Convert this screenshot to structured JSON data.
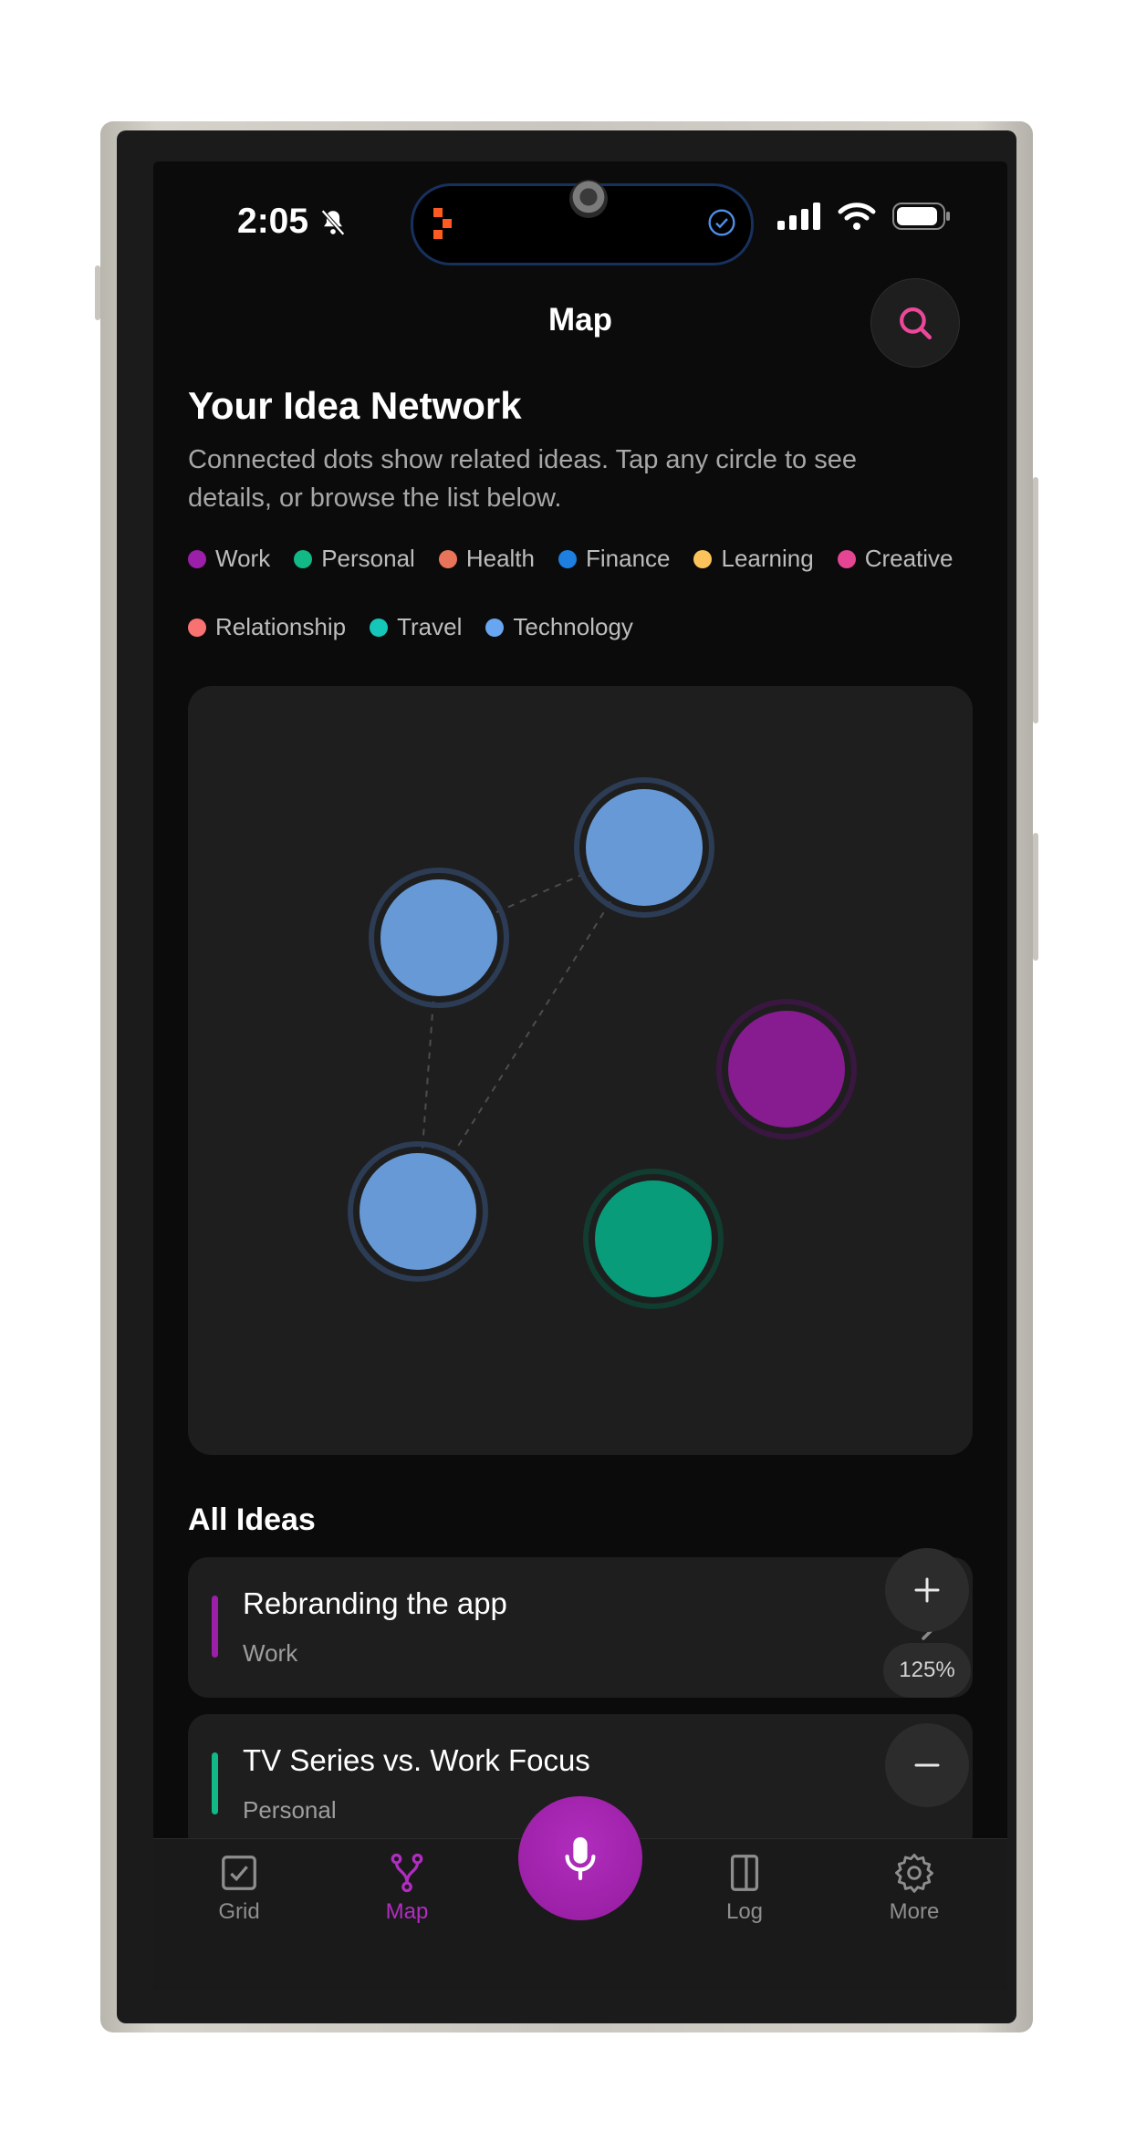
{
  "status": {
    "time": "2:05"
  },
  "header": {
    "title": "Map"
  },
  "intro": {
    "heading": "Your Idea Network",
    "description": "Connected dots show related ideas. Tap any circle to see details, or browse the list below."
  },
  "colors": {
    "accent": "#b02dc0",
    "search_icon": "#ec4899"
  },
  "legend": [
    {
      "label": "Work",
      "color": "#9b1fa8"
    },
    {
      "label": "Personal",
      "color": "#12b886"
    },
    {
      "label": "Health",
      "color": "#e8745a"
    },
    {
      "label": "Finance",
      "color": "#1d7fe0"
    },
    {
      "label": "Learning",
      "color": "#fcc35b"
    },
    {
      "label": "Creative",
      "color": "#e64594"
    },
    {
      "label": "Relationship",
      "color": "#f87272"
    },
    {
      "label": "Travel",
      "color": "#14c7b9"
    },
    {
      "label": "Technology",
      "color": "#69a6f2"
    }
  ],
  "map": {
    "nodes": [
      {
        "category": "Technology",
        "color": "#6699d6",
        "ring": "#2c3c55"
      },
      {
        "category": "Technology",
        "color": "#6699d6",
        "ring": "#2c3c55"
      },
      {
        "category": "Work",
        "color": "#861c8f",
        "ring": "#3a1740"
      },
      {
        "category": "Technology",
        "color": "#6699d6",
        "ring": "#2c3c55"
      },
      {
        "category": "Personal",
        "color": "#089c7b",
        "ring": "#113d31"
      }
    ]
  },
  "list": {
    "heading": "All Ideas",
    "items": [
      {
        "title": "Rebranding the app",
        "category": "Work",
        "color": "#9b1fa8"
      },
      {
        "title": "TV Series vs. Work Focus",
        "category": "Personal",
        "color": "#12b886"
      }
    ]
  },
  "zoom": {
    "level": "125%"
  },
  "tabs": [
    {
      "label": "Grid",
      "icon": "checkbox-icon"
    },
    {
      "label": "Map",
      "icon": "branch-icon",
      "active": true
    },
    {
      "label": "",
      "icon": "microphone-icon"
    },
    {
      "label": "Log",
      "icon": "book-icon"
    },
    {
      "label": "More",
      "icon": "gear-icon"
    }
  ]
}
